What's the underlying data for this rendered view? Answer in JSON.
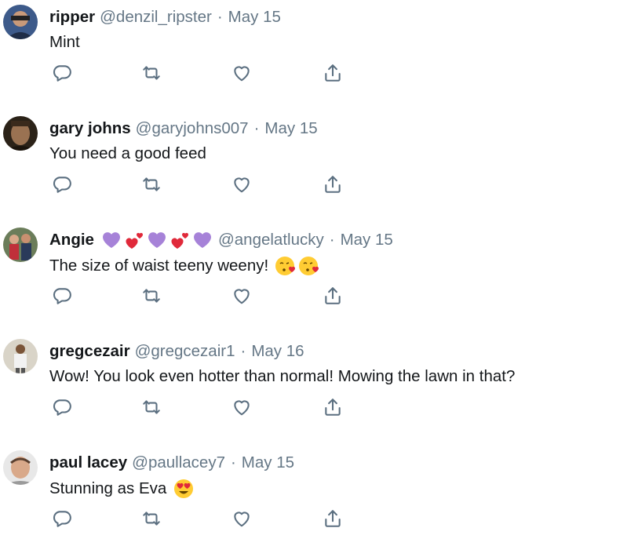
{
  "tweets": [
    {
      "name": "ripper",
      "name_emojis": [],
      "handle": "@denzil_ripster",
      "separator": "·",
      "date": "May 15",
      "text": "Mint",
      "text_emojis": []
    },
    {
      "name": "gary johns",
      "name_emojis": [],
      "handle": "@garyjohns007",
      "separator": "·",
      "date": "May 15",
      "text": "You need a good feed",
      "text_emojis": []
    },
    {
      "name": "Angie",
      "name_emojis": [
        "purple-heart-emoji",
        "heart-exclamation-emoji",
        "purple-heart-emoji",
        "heart-exclamation-emoji",
        "purple-heart-emoji"
      ],
      "handle": "@angelatlucky",
      "separator": "·",
      "date": "May 15",
      "text": "The size of waist teeny weeny!",
      "text_emojis": [
        "face-blowing-kiss-emoji",
        "face-blowing-kiss-emoji"
      ]
    },
    {
      "name": "gregcezair",
      "name_emojis": [],
      "handle": "@gregcezair1",
      "separator": "·",
      "date": "May 16",
      "text": "Wow! You look even hotter than normal! Mowing the lawn in that?",
      "text_emojis": []
    },
    {
      "name": "paul lacey",
      "name_emojis": [],
      "handle": "@paullacey7",
      "separator": "·",
      "date": "May 15",
      "text": "Stunning as Eva",
      "text_emojis": [
        "heart-eyes-emoji"
      ]
    }
  ],
  "action_icons": [
    "reply-icon",
    "retweet-icon",
    "like-icon",
    "share-icon"
  ],
  "colors": {
    "name": "#14171a",
    "meta": "#657786",
    "icon": "#5b6f80",
    "purple_heart": "#a682d8",
    "red_heart": "#e0293a",
    "emoji_face": "#ffcc33"
  }
}
